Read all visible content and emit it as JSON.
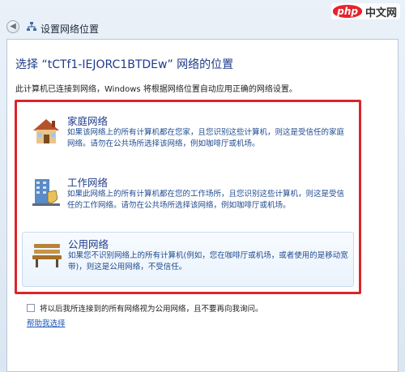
{
  "window": {
    "title": "设置网络位置",
    "back_icon": "back-arrow-icon",
    "network_icon": "network-icon"
  },
  "brand": {
    "logo": "php",
    "name": "中文网"
  },
  "main": {
    "heading": "选择 “tCTf1-IEJORC1BTDEw” 网络的位置",
    "description": "此计算机已连接到网络，Windows 将根据网络位置自动应用正确的网络设置。",
    "highlight_color": "#d9262c",
    "options": [
      {
        "icon": "house-icon",
        "title": "家庭网络",
        "description": "如果该网络上的所有计算机都在您家，且您识别这些计算机，则这是受信任的家庭网络。请勿在公共场所选择该网络，例如咖啡厅或机场。"
      },
      {
        "icon": "office-building-icon",
        "title": "工作网络",
        "description": "如果此网络上的所有计算机都在您的工作场所，且您识别这些计算机，则这是受信任的工作网络。请勿在公共场所选择该网络，例如咖啡厅或机场。"
      },
      {
        "icon": "park-bench-icon",
        "title": "公用网络",
        "description": "如果您不识别网络上的所有计算机(例如，您在咖啡厅或机场，或者使用的是移动宽带)，则这是公用网络，不受信任。"
      }
    ],
    "checkbox_label": "将以后我所连接到的所有网络视为公用网络，且不要再向我询问。",
    "help_link": "帮助我选择"
  }
}
